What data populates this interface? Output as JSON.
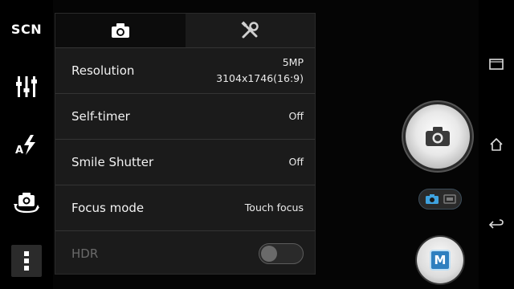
{
  "left_rail": {
    "scene_label": "SCN",
    "items": [
      {
        "name": "scene-button"
      },
      {
        "name": "settings-sliders-icon"
      },
      {
        "name": "auto-flash-icon"
      },
      {
        "name": "switch-camera-icon"
      },
      {
        "name": "more-options-icon"
      }
    ]
  },
  "settings_panel": {
    "tabs": [
      {
        "icon": "camera-icon",
        "active": true
      },
      {
        "icon": "tools-icon",
        "active": false
      }
    ],
    "rows": [
      {
        "label": "Resolution",
        "value_line1": "5MP",
        "value_line2": "3104x1746(16:9)"
      },
      {
        "label": "Self-timer",
        "value": "Off"
      },
      {
        "label": "Smile Shutter",
        "value": "Off"
      },
      {
        "label": "Focus mode",
        "value": "Touch focus"
      },
      {
        "label": "HDR",
        "enabled": false,
        "toggle_on": false
      }
    ]
  },
  "right_controls": {
    "shutter_icon": "camera-icon",
    "mode_switch": {
      "active": "photo",
      "inactive": "video"
    },
    "mode_button_label": "M"
  },
  "nav_bar": {
    "buttons": [
      "recent-apps-icon",
      "home-icon",
      "back-icon"
    ]
  },
  "colors": {
    "accent_blue": "#2e7fbf",
    "panel_bg": "#1b1b1b",
    "disabled_text": "#6a6a6a"
  }
}
